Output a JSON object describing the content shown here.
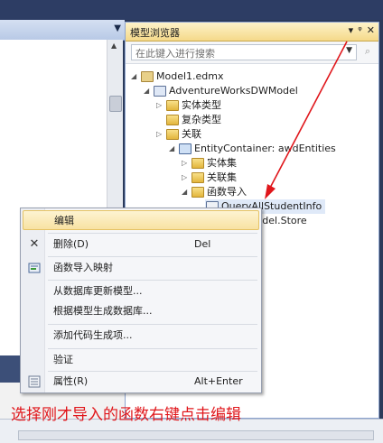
{
  "panel": {
    "title": "模型浏览器",
    "search_placeholder": "在此键入进行搜索",
    "buttons": [
      "▾",
      "ᵠ",
      "✕"
    ]
  },
  "tree": [
    {
      "label": "Model1.edmx",
      "icon": "edmx-file-icon",
      "toggle": "◢"
    },
    {
      "label": "AdventureWorksDWModel",
      "icon": "model-icon",
      "toggle": "◢"
    },
    {
      "label": "实体类型",
      "icon": "folder-icon",
      "toggle": "▷"
    },
    {
      "label": "复杂类型",
      "icon": "folder-icon",
      "toggle": ""
    },
    {
      "label": "关联",
      "icon": "folder-icon",
      "toggle": "▷"
    },
    {
      "label": "EntityContainer: awdEntities",
      "icon": "entity-container-icon",
      "toggle": "◢"
    },
    {
      "label": "实体集",
      "icon": "folder-icon",
      "toggle": "▷"
    },
    {
      "label": "关联集",
      "icon": "folder-icon",
      "toggle": "▷"
    },
    {
      "label": "函数导入",
      "icon": "folder-icon",
      "toggle": "◢"
    },
    {
      "label": "QueryAllStudentInfo",
      "icon": "function-import-icon",
      "toggle": ""
    },
    {
      "label": "sDWModel.Store",
      "icon": "store-icon",
      "toggle": ""
    }
  ],
  "context_menu": {
    "items": [
      {
        "label": "编辑",
        "key": "",
        "icon": ""
      },
      {
        "label": "删除(D)",
        "key": "Del",
        "icon": "✕"
      },
      {
        "label": "函数导入映射",
        "key": "",
        "icon": "mapping-icon"
      },
      {
        "label": "从数据库更新模型...",
        "key": "",
        "icon": ""
      },
      {
        "label": "根据模型生成数据库...",
        "key": "",
        "icon": ""
      },
      {
        "label": "添加代码生成项...",
        "key": "",
        "icon": ""
      },
      {
        "label": "验证",
        "key": "",
        "icon": ""
      },
      {
        "label": "属性(R)",
        "key": "Alt+Enter",
        "icon": "properties-icon"
      }
    ]
  },
  "caption": "选择刚才导入的函数右键点击编辑",
  "colors": {
    "caption": "#e0161b",
    "arrow": "#e0161b",
    "highlight": "#f8e2a2"
  }
}
